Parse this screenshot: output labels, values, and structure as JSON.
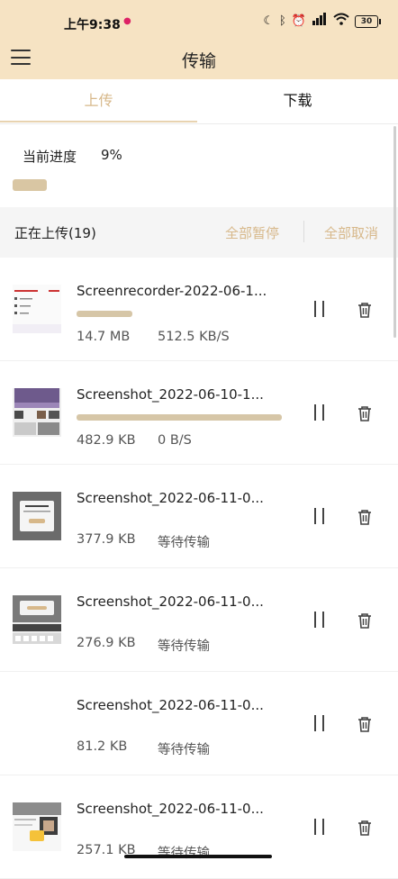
{
  "status_bar": {
    "time": "上午9:38",
    "battery": "30"
  },
  "app_bar": {
    "title": "传输"
  },
  "tabs": [
    {
      "label": "上传",
      "active": true
    },
    {
      "label": "下载",
      "active": false
    }
  ],
  "progress": {
    "label": "当前进度",
    "value_text": "9%",
    "fraction": 0.09
  },
  "section": {
    "title": "正在上传(19)",
    "pause_all": "全部暂停",
    "cancel_all": "全部取消"
  },
  "colors": {
    "accent": "#d7b88a",
    "header_bg": "#f6e3c3",
    "bar_fill": "#d6c6a7"
  },
  "items": [
    {
      "name": "Screenrecorder-2022-06-1...",
      "size": "14.7 MB",
      "status": "512.5 KB/S",
      "progress": 0.27,
      "thumb": "recorder"
    },
    {
      "name": "Screenshot_2022-06-10-1...",
      "size": "482.9 KB",
      "status": "0 B/S",
      "progress": 1.0,
      "thumb": "purple"
    },
    {
      "name": "Screenshot_2022-06-11-0...",
      "size": "377.9 KB",
      "status": "等待传输",
      "progress": null,
      "thumb": "dialog"
    },
    {
      "name": "Screenshot_2022-06-11-0...",
      "size": "276.9 KB",
      "status": "等待传输",
      "progress": null,
      "thumb": "keyboard"
    },
    {
      "name": "Screenshot_2022-06-11-0...",
      "size": "81.2 KB",
      "status": "等待传输",
      "progress": null,
      "thumb": "blank"
    },
    {
      "name": "Screenshot_2022-06-11-0...",
      "size": "257.1 KB",
      "status": "等待传输",
      "progress": null,
      "thumb": "photo"
    }
  ]
}
